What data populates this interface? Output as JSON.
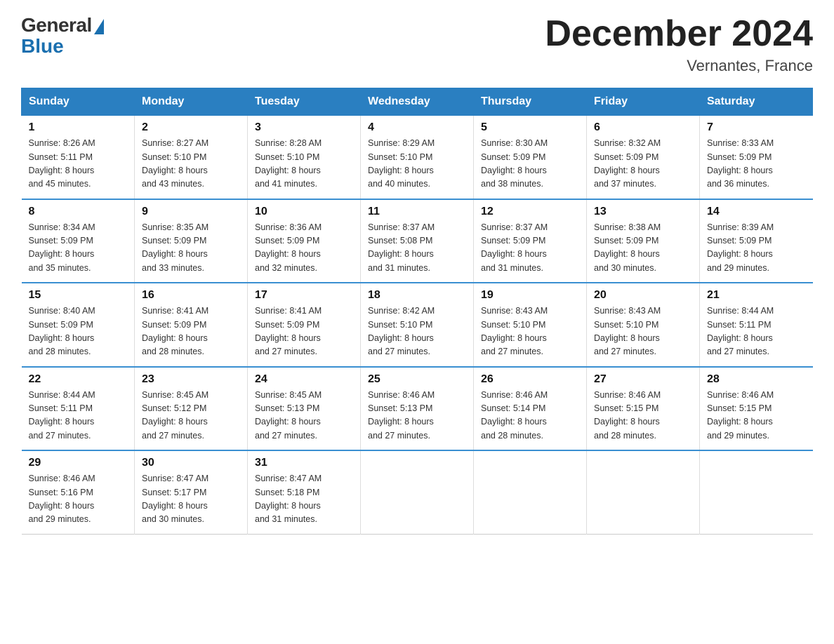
{
  "header": {
    "logo_general": "General",
    "logo_blue": "Blue",
    "month_title": "December 2024",
    "location": "Vernantes, France"
  },
  "days_of_week": [
    "Sunday",
    "Monday",
    "Tuesday",
    "Wednesday",
    "Thursday",
    "Friday",
    "Saturday"
  ],
  "weeks": [
    [
      {
        "num": "1",
        "sunrise": "8:26 AM",
        "sunset": "5:11 PM",
        "daylight": "8 hours and 45 minutes."
      },
      {
        "num": "2",
        "sunrise": "8:27 AM",
        "sunset": "5:10 PM",
        "daylight": "8 hours and 43 minutes."
      },
      {
        "num": "3",
        "sunrise": "8:28 AM",
        "sunset": "5:10 PM",
        "daylight": "8 hours and 41 minutes."
      },
      {
        "num": "4",
        "sunrise": "8:29 AM",
        "sunset": "5:10 PM",
        "daylight": "8 hours and 40 minutes."
      },
      {
        "num": "5",
        "sunrise": "8:30 AM",
        "sunset": "5:09 PM",
        "daylight": "8 hours and 38 minutes."
      },
      {
        "num": "6",
        "sunrise": "8:32 AM",
        "sunset": "5:09 PM",
        "daylight": "8 hours and 37 minutes."
      },
      {
        "num": "7",
        "sunrise": "8:33 AM",
        "sunset": "5:09 PM",
        "daylight": "8 hours and 36 minutes."
      }
    ],
    [
      {
        "num": "8",
        "sunrise": "8:34 AM",
        "sunset": "5:09 PM",
        "daylight": "8 hours and 35 minutes."
      },
      {
        "num": "9",
        "sunrise": "8:35 AM",
        "sunset": "5:09 PM",
        "daylight": "8 hours and 33 minutes."
      },
      {
        "num": "10",
        "sunrise": "8:36 AM",
        "sunset": "5:09 PM",
        "daylight": "8 hours and 32 minutes."
      },
      {
        "num": "11",
        "sunrise": "8:37 AM",
        "sunset": "5:08 PM",
        "daylight": "8 hours and 31 minutes."
      },
      {
        "num": "12",
        "sunrise": "8:37 AM",
        "sunset": "5:09 PM",
        "daylight": "8 hours and 31 minutes."
      },
      {
        "num": "13",
        "sunrise": "8:38 AM",
        "sunset": "5:09 PM",
        "daylight": "8 hours and 30 minutes."
      },
      {
        "num": "14",
        "sunrise": "8:39 AM",
        "sunset": "5:09 PM",
        "daylight": "8 hours and 29 minutes."
      }
    ],
    [
      {
        "num": "15",
        "sunrise": "8:40 AM",
        "sunset": "5:09 PM",
        "daylight": "8 hours and 28 minutes."
      },
      {
        "num": "16",
        "sunrise": "8:41 AM",
        "sunset": "5:09 PM",
        "daylight": "8 hours and 28 minutes."
      },
      {
        "num": "17",
        "sunrise": "8:41 AM",
        "sunset": "5:09 PM",
        "daylight": "8 hours and 27 minutes."
      },
      {
        "num": "18",
        "sunrise": "8:42 AM",
        "sunset": "5:10 PM",
        "daylight": "8 hours and 27 minutes."
      },
      {
        "num": "19",
        "sunrise": "8:43 AM",
        "sunset": "5:10 PM",
        "daylight": "8 hours and 27 minutes."
      },
      {
        "num": "20",
        "sunrise": "8:43 AM",
        "sunset": "5:10 PM",
        "daylight": "8 hours and 27 minutes."
      },
      {
        "num": "21",
        "sunrise": "8:44 AM",
        "sunset": "5:11 PM",
        "daylight": "8 hours and 27 minutes."
      }
    ],
    [
      {
        "num": "22",
        "sunrise": "8:44 AM",
        "sunset": "5:11 PM",
        "daylight": "8 hours and 27 minutes."
      },
      {
        "num": "23",
        "sunrise": "8:45 AM",
        "sunset": "5:12 PM",
        "daylight": "8 hours and 27 minutes."
      },
      {
        "num": "24",
        "sunrise": "8:45 AM",
        "sunset": "5:13 PM",
        "daylight": "8 hours and 27 minutes."
      },
      {
        "num": "25",
        "sunrise": "8:46 AM",
        "sunset": "5:13 PM",
        "daylight": "8 hours and 27 minutes."
      },
      {
        "num": "26",
        "sunrise": "8:46 AM",
        "sunset": "5:14 PM",
        "daylight": "8 hours and 28 minutes."
      },
      {
        "num": "27",
        "sunrise": "8:46 AM",
        "sunset": "5:15 PM",
        "daylight": "8 hours and 28 minutes."
      },
      {
        "num": "28",
        "sunrise": "8:46 AM",
        "sunset": "5:15 PM",
        "daylight": "8 hours and 29 minutes."
      }
    ],
    [
      {
        "num": "29",
        "sunrise": "8:46 AM",
        "sunset": "5:16 PM",
        "daylight": "8 hours and 29 minutes."
      },
      {
        "num": "30",
        "sunrise": "8:47 AM",
        "sunset": "5:17 PM",
        "daylight": "8 hours and 30 minutes."
      },
      {
        "num": "31",
        "sunrise": "8:47 AM",
        "sunset": "5:18 PM",
        "daylight": "8 hours and 31 minutes."
      },
      null,
      null,
      null,
      null
    ]
  ],
  "labels": {
    "sunrise": "Sunrise:",
    "sunset": "Sunset:",
    "daylight": "Daylight:"
  }
}
